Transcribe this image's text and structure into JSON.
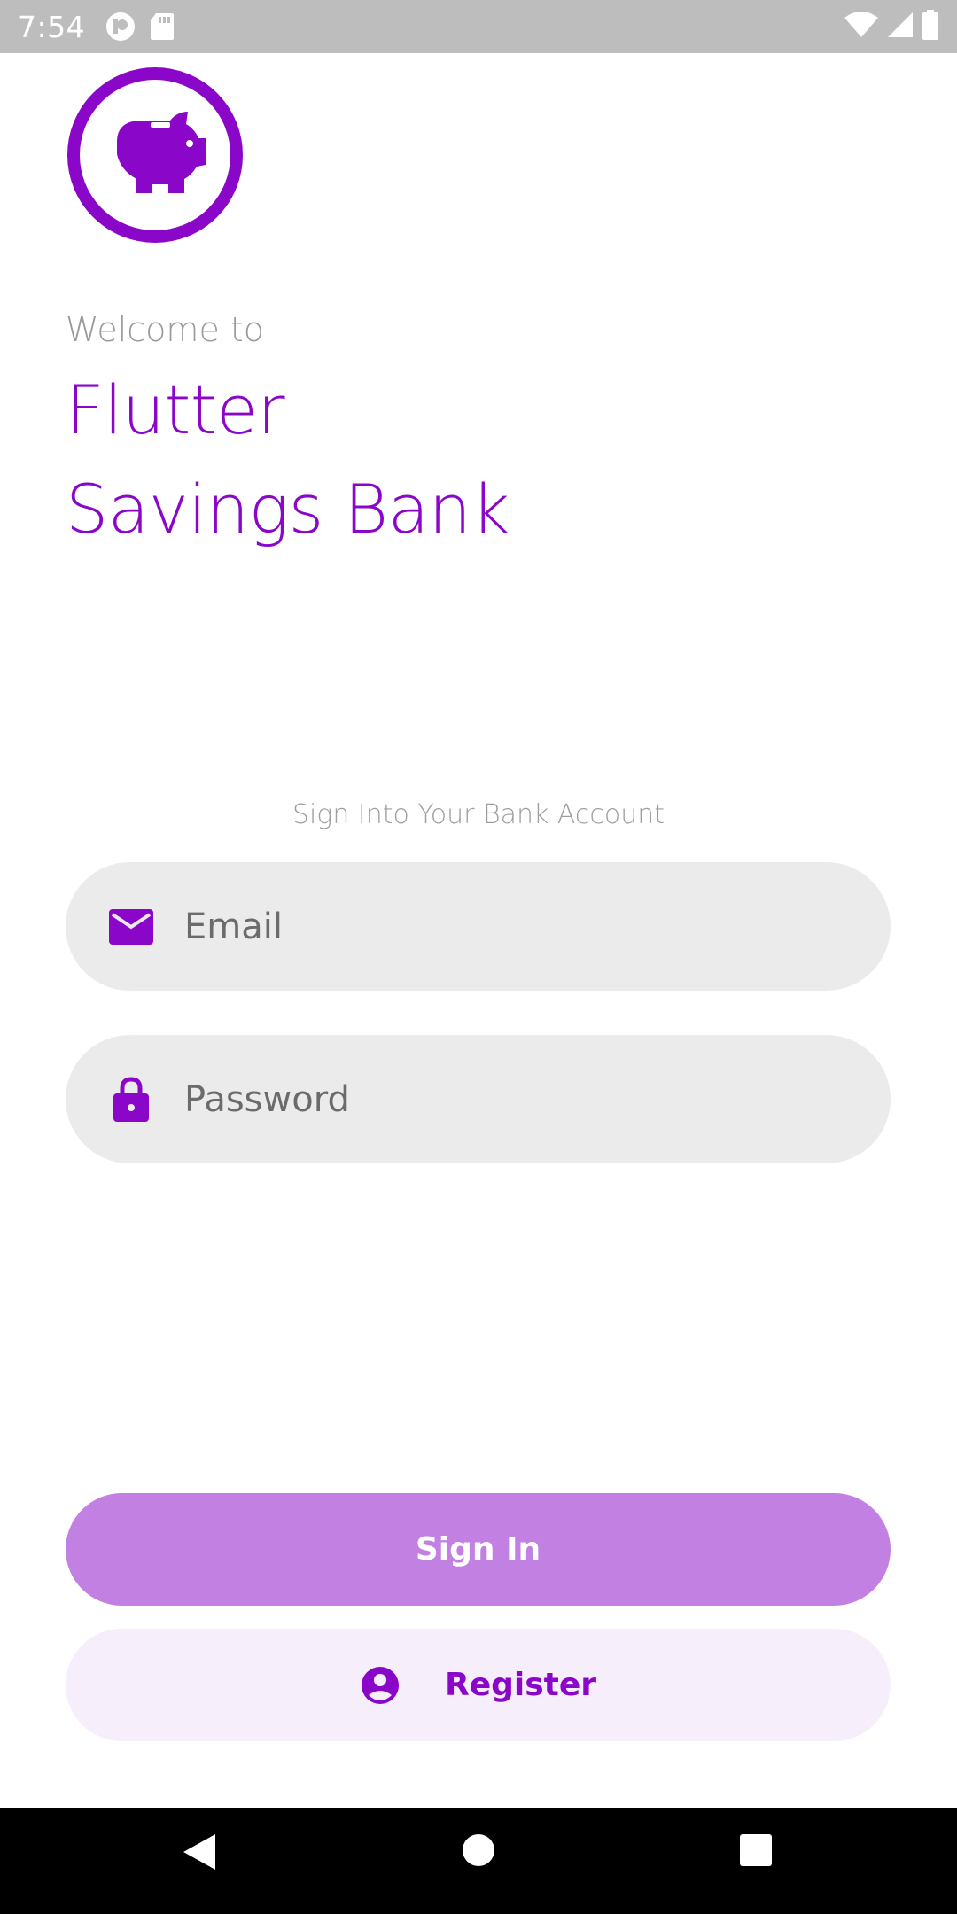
{
  "status_bar": {
    "time": "7:54",
    "icons": [
      "pocket-casts-icon",
      "sd-card-icon",
      "wifi-icon",
      "cell-signal-icon",
      "battery-icon"
    ]
  },
  "brand": {
    "logo_icon": "piggy-bank-icon",
    "accent_color": "#8a06c8",
    "welcome": "Welcome to",
    "title_line_1": "Flutter",
    "title_line_2": "Savings Bank"
  },
  "form": {
    "caption": "Sign Into Your Bank Account",
    "email": {
      "icon": "mail-icon",
      "placeholder": "Email"
    },
    "password": {
      "icon": "lock-icon",
      "placeholder": "Password"
    }
  },
  "actions": {
    "sign_in_label": "Sign In",
    "register_label": "Register",
    "register_icon": "account-circle-icon"
  },
  "nav": {
    "icons": [
      "back-icon",
      "home-icon",
      "recent-apps-icon"
    ]
  }
}
